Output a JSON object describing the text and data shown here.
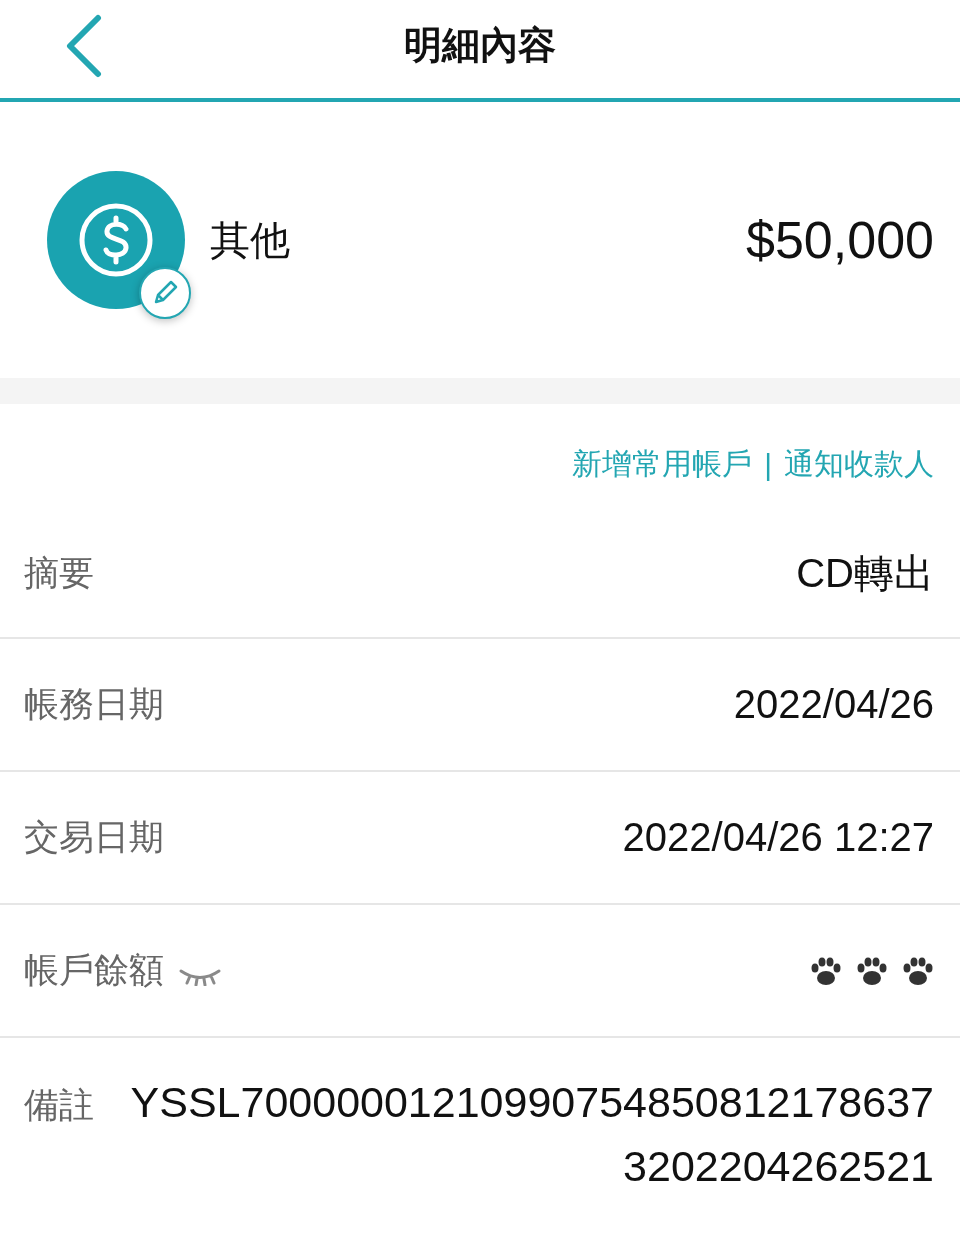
{
  "header": {
    "title": "明細內容"
  },
  "summary": {
    "category": "其他",
    "amount": "$50,000"
  },
  "links": {
    "items": [
      "新增常用帳戶",
      "通知收款人"
    ],
    "separator": "|"
  },
  "rows": [
    {
      "kind": "text",
      "label": "摘要",
      "value": "CD轉出"
    },
    {
      "kind": "text",
      "label": "帳務日期",
      "value": "2022/04/26"
    },
    {
      "kind": "text",
      "label": "交易日期",
      "value": "2022/04/26 12:27"
    },
    {
      "kind": "balance",
      "label": "帳戶餘額",
      "visible": false
    },
    {
      "kind": "remark",
      "label": "備註",
      "value": "YSSL700000012109907548508121786373202204262521"
    }
  ]
}
